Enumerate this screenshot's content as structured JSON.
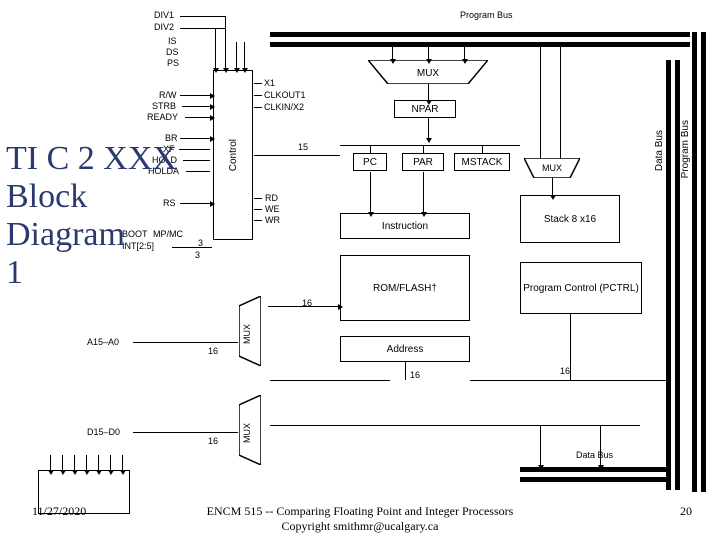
{
  "title_lines": [
    "TI C 2 XXX",
    "Block",
    "Diagram",
    "1"
  ],
  "buses": {
    "program_bus": "Program Bus",
    "data_bus_r": "Data Bus",
    "program_bus_r": "Program Bus",
    "data_bus_b": "Data Bus"
  },
  "left_signals": {
    "div1": "DIV1",
    "div2": "DIV2",
    "is": "IS",
    "ds": "DS",
    "ps": "PS",
    "rw": "R/W",
    "strb": "STRB",
    "ready": "READY",
    "br": "BR",
    "xf": "XF",
    "hold": "HOLD",
    "holda": "HOLDA",
    "rs": "RS",
    "boot": "BOOT",
    "mpmc": "MP/MC",
    "int25": "INT[2:5]"
  },
  "right_of_control": {
    "x1": "X1",
    "clkout1": "CLKOUT1",
    "clkinx2": "CLKIN/X2",
    "rd": "RD",
    "we": "WE",
    "wr": "WR"
  },
  "blocks": {
    "control": "Control",
    "mux_top": "MUX",
    "npar": "NPAR",
    "pc": "PC",
    "par": "PAR",
    "mstack": "MSTACK",
    "mux_mid": "MUX",
    "instruction": "Instruction",
    "romflash": "ROM/FLASH†",
    "address": "Address",
    "stack": "Stack 8 x16",
    "pctrl": "Program Control (PCTRL)",
    "mux_left": "MUX",
    "mux_left2": "MUX"
  },
  "addr": {
    "a15a0": "A15–A0",
    "d15d0": "D15–D0"
  },
  "bus16": "16",
  "bus15": "15",
  "bus3_top": "3",
  "bus3_mid": "3",
  "footer": {
    "date": "11/27/2020",
    "center1": "ENCM 515 -- Comparing Floating Point and Integer Processors",
    "center2": "Copyright smithmr@ucalgary.ca",
    "page": "20"
  }
}
